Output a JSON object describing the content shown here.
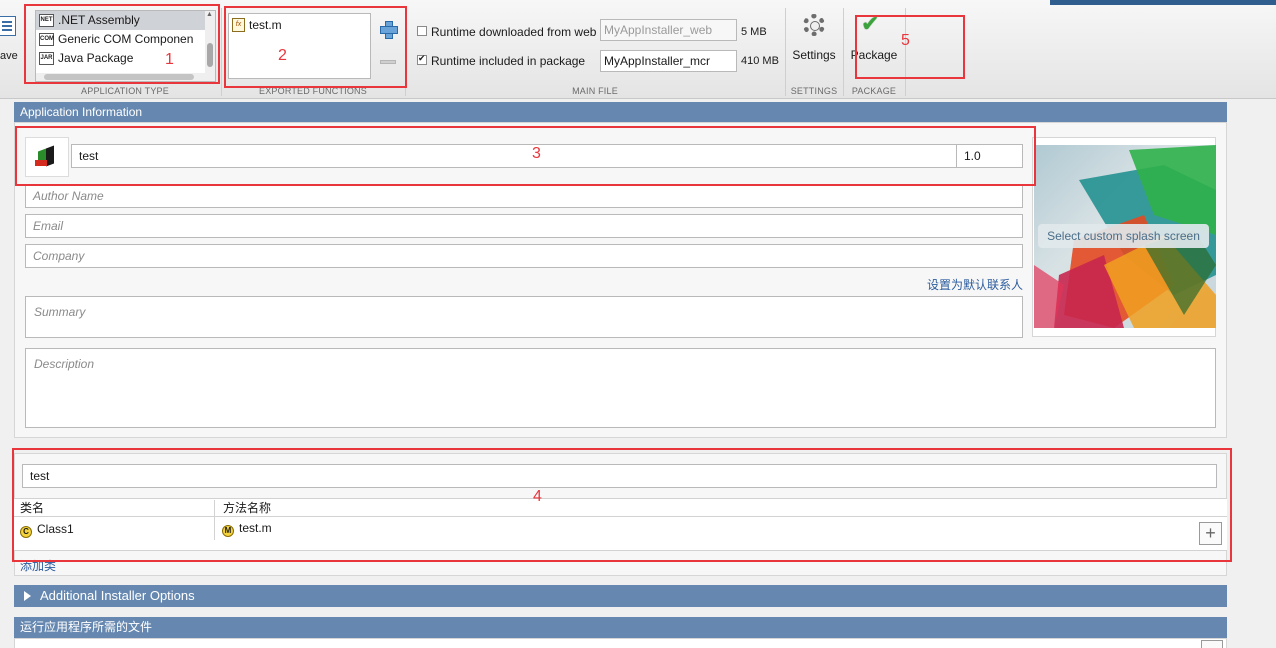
{
  "toolstrip": {
    "save_label": "ave",
    "application_type": {
      "section_label": "APPLICATION TYPE",
      "items": [
        {
          "label": ".NET Assembly",
          "icon": "net-assembly-icon",
          "icon_text": "NET",
          "selected": true
        },
        {
          "label": "Generic COM Componen",
          "icon": "com-component-icon",
          "icon_text": "COM",
          "selected": false
        },
        {
          "label": "Java Package",
          "icon": "java-package-icon",
          "icon_text": "JAR",
          "selected": false
        }
      ]
    },
    "exported_functions": {
      "section_label": "EXPORTED FUNCTIONS",
      "items": [
        {
          "label": "test.m",
          "icon": "function-file-icon"
        }
      ],
      "fx_text": "fx"
    },
    "main_file": {
      "section_label": "MAIN FILE",
      "runtime_web": {
        "label": "Runtime downloaded from web",
        "checked": false,
        "value": "MyAppInstaller_web",
        "size": "5 MB"
      },
      "runtime_package": {
        "label": "Runtime included in package",
        "checked": true,
        "value": "MyAppInstaller_mcr",
        "size": "410 MB"
      }
    },
    "settings": {
      "section_label": "SETTINGS",
      "button_label": "Settings",
      "icon": "gear-icon"
    },
    "package": {
      "section_label": "PACKAGE",
      "button_label": "Package",
      "icon": "checkmark-icon"
    }
  },
  "annotations": [
    "1",
    "2",
    "3",
    "4",
    "5"
  ],
  "application_information": {
    "header": "Application Information",
    "app_name": "test",
    "version": "1.0",
    "author_placeholder": "Author Name",
    "email_placeholder": "Email",
    "company_placeholder": "Company",
    "set_default_contact": "设置为默认联系人",
    "summary_placeholder": "Summary",
    "description_placeholder": "Description",
    "splash_label": "Select custom splash screen"
  },
  "class_mapping": {
    "library_name": "test",
    "columns": [
      "类名",
      "方法名称"
    ],
    "rows": [
      {
        "class_name": "Class1",
        "class_icon_text": "C",
        "method": "test.m",
        "method_icon_text": "M"
      }
    ],
    "add_class_label": "添加类",
    "add_button_symbol": "+"
  },
  "additional_installer_options": {
    "header": "Additional Installer Options"
  },
  "required_files": {
    "header": "运行应用程序所需的文件"
  },
  "colors": {
    "section_header": "#6688b0",
    "annotation": "#e8363c",
    "link": "#2c5c9e"
  }
}
